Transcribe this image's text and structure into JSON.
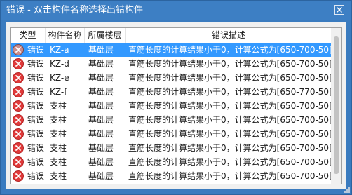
{
  "window": {
    "title": "错误 - 双击构件名称选择出错构件"
  },
  "colors": {
    "titlebar": "#3d7fc4",
    "selection": "#3399ff",
    "error_icon": "#e03a3a"
  },
  "icons": {
    "close": "close-icon",
    "error": "error-circle-x-icon"
  },
  "table": {
    "columns": [
      "类型",
      "构件名称",
      "所属楼层",
      "错误描述"
    ],
    "rows": [
      {
        "type": "错误",
        "name": "KZ-a",
        "floor": "基础层",
        "desc": "直筋长度的计算结果小于0，计算公式为[650-700-50]"
      },
      {
        "type": "错误",
        "name": "KZ-d",
        "floor": "基础层",
        "desc": "直筋长度的计算结果小于0，计算公式为[650-700-50]"
      },
      {
        "type": "错误",
        "name": "KZ-e",
        "floor": "基础层",
        "desc": "直筋长度的计算结果小于0，计算公式为[650-700-50]"
      },
      {
        "type": "错误",
        "name": "KZ-f",
        "floor": "基础层",
        "desc": "直筋长度的计算结果小于0，计算公式为[650-770-50]"
      },
      {
        "type": "错误",
        "name": "支柱",
        "floor": "基础层",
        "desc": "直筋长度的计算结果小于0，计算公式为[650-700-50]"
      },
      {
        "type": "错误",
        "name": "支柱",
        "floor": "基础层",
        "desc": "直筋长度的计算结果小于0，计算公式为[650-700-50]"
      },
      {
        "type": "错误",
        "name": "支柱",
        "floor": "基础层",
        "desc": "直筋长度的计算结果小于0，计算公式为[650-700-50]"
      },
      {
        "type": "错误",
        "name": "支柱",
        "floor": "基础层",
        "desc": "直筋长度的计算结果小于0，计算公式为[650-700-50]"
      },
      {
        "type": "错误",
        "name": "支柱",
        "floor": "基础层",
        "desc": "直筋长度的计算结果小于0，计算公式为[650-700-50]"
      },
      {
        "type": "错误",
        "name": "支柱",
        "floor": "基础层",
        "desc": "直筋长度的计算结果小于0，计算公式为[650-700-50]"
      }
    ]
  }
}
